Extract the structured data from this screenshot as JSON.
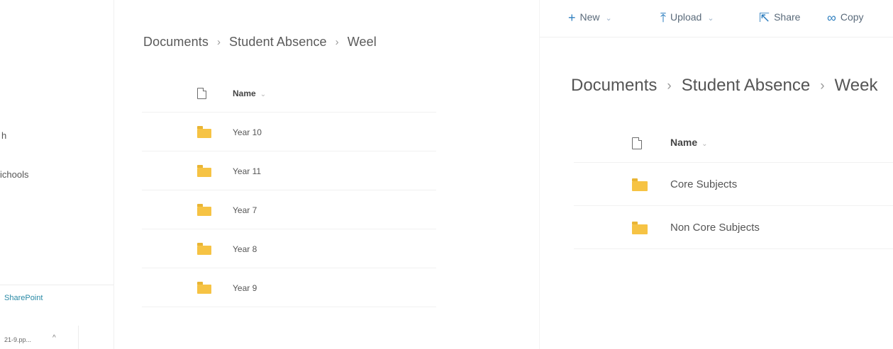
{
  "left_panel": {
    "nav": {
      "items": [
        "h",
        "ichools"
      ],
      "sharepoint_link": "SharePoint",
      "download": {
        "name": "21-9.pp...",
        "chevron": "^"
      }
    },
    "breadcrumb": [
      "Documents",
      "Student Absence",
      "Weel"
    ],
    "list": {
      "header": {
        "name_label": "Name",
        "sort_chevron": "⌄"
      },
      "rows": [
        {
          "label": "Year 10",
          "icon": "folder-icon"
        },
        {
          "label": "Year 11",
          "icon": "folder-icon"
        },
        {
          "label": "Year 7",
          "icon": "folder-icon"
        },
        {
          "label": "Year 8",
          "icon": "folder-icon"
        },
        {
          "label": "Year 9",
          "icon": "folder-icon"
        }
      ]
    }
  },
  "right_panel": {
    "command_bar": {
      "new_label": "New",
      "upload_label": "Upload",
      "share_label": "Share",
      "copy_label": "Copy",
      "chevron": "⌄"
    },
    "breadcrumb": [
      "Documents",
      "Student Absence",
      "Week"
    ],
    "list": {
      "header": {
        "name_label": "Name",
        "sort_chevron": "⌄"
      },
      "rows": [
        {
          "label": "Core Subjects",
          "icon": "folder-icon"
        },
        {
          "label": "Non Core Subjects",
          "icon": "folder-icon"
        }
      ]
    }
  },
  "colors": {
    "folder": "#f6c344",
    "accent": "#2f7fbf",
    "sharepoint_link": "#2a8aa6"
  },
  "separator": "›"
}
